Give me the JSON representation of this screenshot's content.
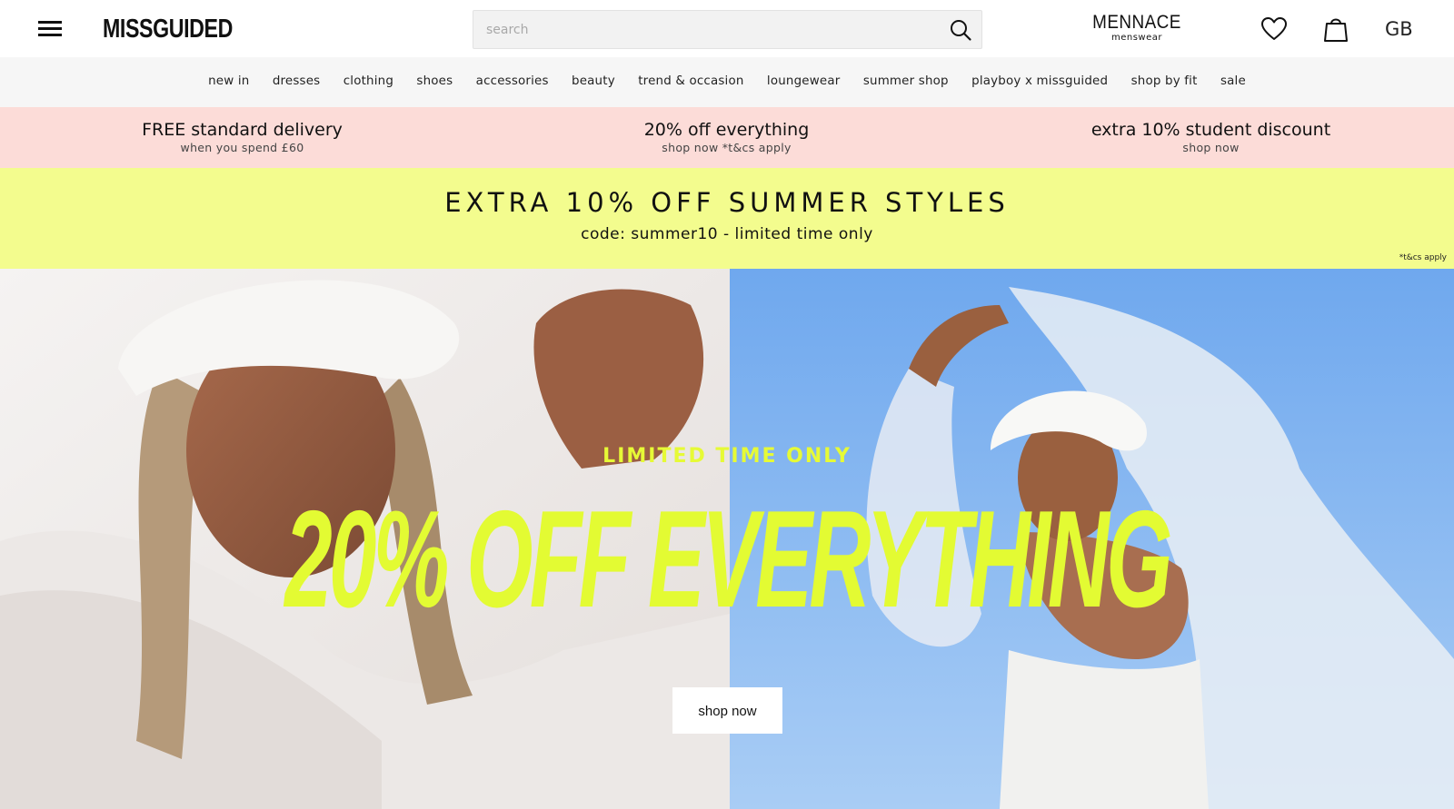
{
  "header": {
    "logo": "MISSGUIDED",
    "search_placeholder": "search",
    "mennace": "MENNACE",
    "mennace_sub": "menswear",
    "country": "GB"
  },
  "nav": {
    "items": [
      "new in",
      "dresses",
      "clothing",
      "shoes",
      "accessories",
      "beauty",
      "trend & occasion",
      "loungewear",
      "summer shop",
      "playboy x missguided",
      "shop by fit",
      "sale"
    ]
  },
  "promo": [
    {
      "title": "FREE standard delivery",
      "subtitle": "when you spend £60"
    },
    {
      "title": "20% off everything",
      "subtitle": "shop now *t&cs apply"
    },
    {
      "title": "extra 10% student discount",
      "subtitle": "shop now"
    }
  ],
  "summer_banner": {
    "headline": "EXTRA 10% OFF SUMMER STYLES",
    "sub": "code: summer10 - limited time only",
    "terms": "*t&cs apply"
  },
  "hero": {
    "kicker": "LIMITED TIME ONLY",
    "headline": "20% OFF EVERYTHING",
    "cta": "shop now"
  },
  "colors": {
    "promo_bg": "#fcdcd8",
    "summer_bg": "#f3fc8e",
    "hero_accent": "#e3fb33",
    "sky_blue": "#7fb3ee"
  }
}
